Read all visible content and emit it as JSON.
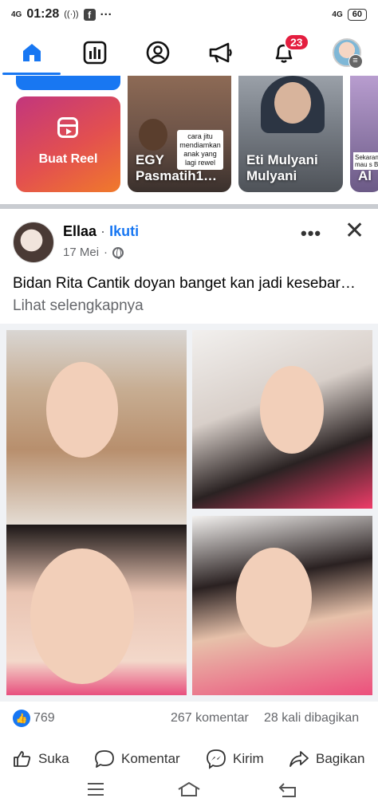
{
  "status_bar": {
    "network_left": "4G",
    "time": "01:28",
    "network_right": "4G",
    "battery": "60"
  },
  "nav": {
    "tabs": [
      "home",
      "feeds",
      "profile",
      "video",
      "notifications",
      "menu"
    ],
    "notifications_badge": "23"
  },
  "stories": {
    "reel_label": "Buat Reel",
    "items": [
      {
        "name": "EGY Pasmatih1…",
        "note": "cara jitu mendiamkan anak yang lagi rewel"
      },
      {
        "name": "Eti Mulyani Mulyani"
      },
      {
        "name": "Al",
        "note": "Sekarang mau s Ba"
      }
    ]
  },
  "post": {
    "author": "Ellaa",
    "separator": "·",
    "follow_label": "Ikuti",
    "date": "17 Mei",
    "text": "Bidan Rita Cantik doyan banget kan jadi kesebar…",
    "see_more": "Lihat selengkapnya",
    "reactions_count": "769",
    "comments": "267 komentar",
    "shares": "28 kali dibagikan",
    "actions": {
      "like": "Suka",
      "comment": "Komentar",
      "send": "Kirim",
      "share": "Bagikan"
    }
  },
  "colors": {
    "accent": "#1877f2",
    "badge": "#e41e3f",
    "muted_text": "#65676b"
  }
}
